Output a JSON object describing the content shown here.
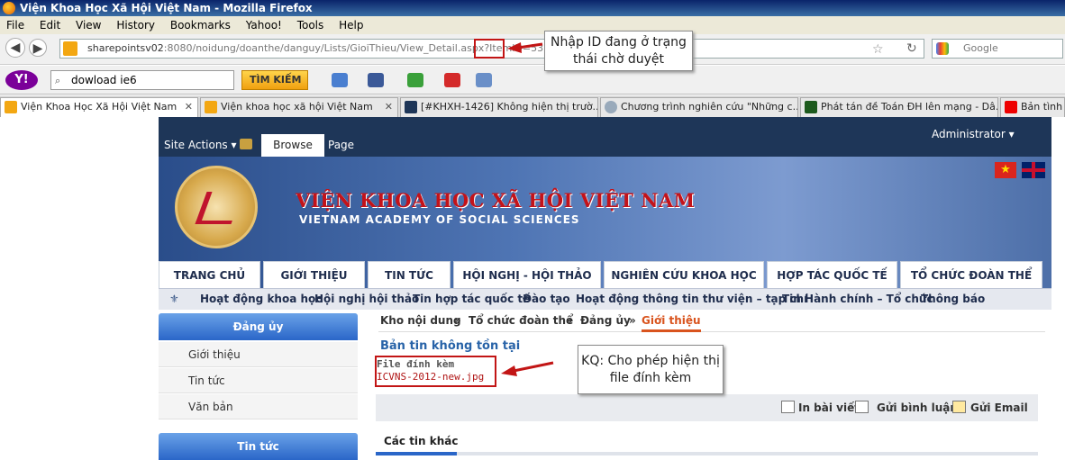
{
  "window": {
    "title": "Viện Khoa Học Xã Hội Việt Nam - Mozilla Firefox"
  },
  "menu": [
    "File",
    "Edit",
    "View",
    "History",
    "Bookmarks",
    "Yahoo!",
    "Tools",
    "Help"
  ],
  "address": {
    "host": "sharepointsv02",
    "rest": ":8080/noidung/doanthe/danguy/Lists/GioiThieu/View_Detail.aspx?ItemID=53"
  },
  "search_engine": {
    "placeholder": "Google"
  },
  "yahoo": {
    "logo": "Y!",
    "query": "dowload ie6",
    "button": "TÌM KIẾM"
  },
  "tabs": [
    "Viện Khoa Học Xã Hội Việt Nam",
    "Viện khoa học xã hội Việt Nam",
    "[#KHXH-1426] Không hiện thị trườ...",
    "Chương trình nghiên cứu \"Những c...",
    "Phát tán đề Toán ĐH lên mạng - Dâ...",
    "Bản tình ca..."
  ],
  "sharepoint": {
    "site_actions": "Site Actions ▾",
    "browse": "Browse",
    "page": "Page",
    "user": "Administrator ▾"
  },
  "site": {
    "title_vn": "VIỆN KHOA HỌC XÃ HỘI VIỆT NAM",
    "title_en": "VIETNAM ACADEMY OF SOCIAL SCIENCES"
  },
  "main_nav": [
    "TRANG CHỦ",
    "GIỚI THIỆU",
    "TIN TỨC",
    "HỘI NGHỊ - HỘI THẢO",
    "NGHIÊN CỨU KHOA HỌC",
    "HỢP TÁC QUỐC TẾ",
    "TỔ CHỨC ĐOÀN THỂ"
  ],
  "sub_nav": [
    "Hoạt động khoa học",
    "Hội nghị hội thảo",
    "Tin hợp tác quốc tế",
    "Đào tạo",
    "Hoạt động thông tin thư viện – tạp chí",
    "Tin Hành chính – Tổ chức",
    "Thông báo"
  ],
  "sidebar": {
    "head1": "Đảng ủy",
    "items": [
      "Giới thiệu",
      "Tin tức",
      "Văn bản"
    ],
    "head2": "Tin tức"
  },
  "breadcrumb": [
    "Kho nội dung",
    "»",
    "Tổ chức đoàn thể",
    "»",
    "Đảng ủy",
    "»",
    "Giới thiệu"
  ],
  "article": {
    "title": "Bản tin không tồn tại",
    "attach_label": "File đính kèm",
    "attach_file": "ICVNS-2012-new.jpg"
  },
  "actions": [
    "In bài viết",
    "Gửi bình luận",
    "Gửi Email"
  ],
  "other_news": "Các tin khác",
  "annotations": {
    "note1": "Nhập ID đang ở trạng thái chờ duyệt",
    "note2": "KQ: Cho phép hiện thị file đính kèm"
  },
  "colors": {
    "accent_red": "#c21515",
    "nav_dark": "#1e3658",
    "link_orange": "#d9541e"
  }
}
